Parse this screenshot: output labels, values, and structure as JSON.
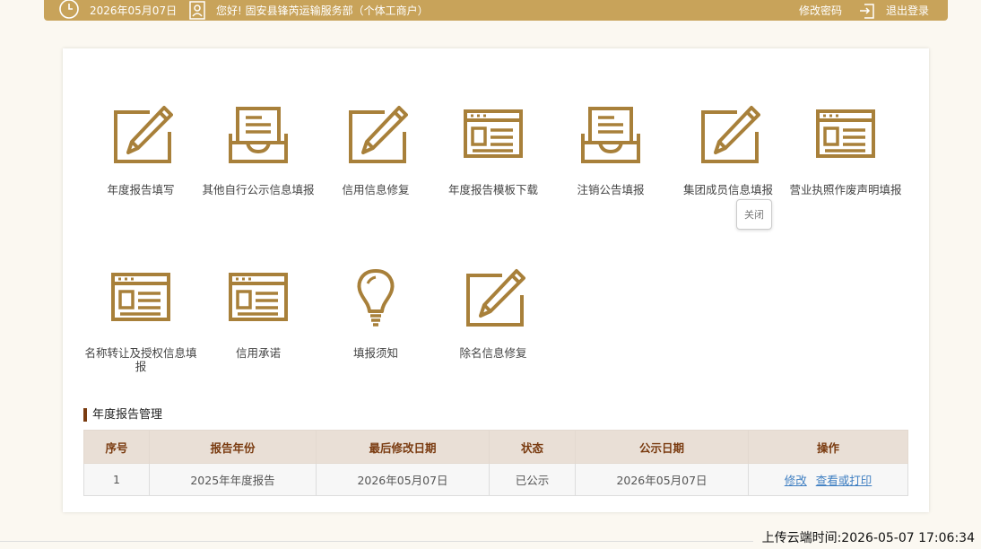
{
  "header": {
    "date": "2026年05月07日",
    "greeting": "您好! 固安县锋芮运输服务部（个体工商户）",
    "change_password": "修改密码",
    "logout": "退出登录"
  },
  "tiles": [
    {
      "label": "年度报告填写",
      "icon": "edit-form-icon"
    },
    {
      "label": "其他自行公示信息填报",
      "icon": "inbox-tray-icon"
    },
    {
      "label": "信用信息修复",
      "icon": "edit-form-icon"
    },
    {
      "label": "年度报告模板下载",
      "icon": "browser-window-icon"
    },
    {
      "label": "注销公告填报",
      "icon": "inbox-tray-icon"
    },
    {
      "label": "集团成员信息填报",
      "icon": "edit-form-icon"
    },
    {
      "label": "营业执照作废声明填报",
      "icon": "browser-window-icon"
    },
    {
      "label": "名称转让及授权信息填报",
      "icon": "browser-window-icon"
    },
    {
      "label": "信用承诺",
      "icon": "browser-window-icon"
    },
    {
      "label": "填报须知",
      "icon": "lightbulb-icon"
    },
    {
      "label": "除名信息修复",
      "icon": "edit-form-icon"
    }
  ],
  "tooltip": {
    "label": "关闭"
  },
  "report_section": {
    "title": "年度报告管理",
    "columns": [
      "序号",
      "报告年份",
      "最后修改日期",
      "状态",
      "公示日期",
      "操作"
    ],
    "rows": [
      {
        "index": "1",
        "report_year": "2025年年度报告",
        "last_modified": "2026年05月07日",
        "status": "已公示",
        "publish_date": "2026年05月07日",
        "actions": [
          "修改",
          "查看或打印"
        ]
      }
    ]
  },
  "upload_time": "上传云端时间:2026-05-07 17:06:34",
  "colors": {
    "header_bg": "#c8a35a",
    "icon_gold": "#a8803a",
    "table_header_bg": "#e9dfd6",
    "accent_brown": "#7a3b10"
  }
}
